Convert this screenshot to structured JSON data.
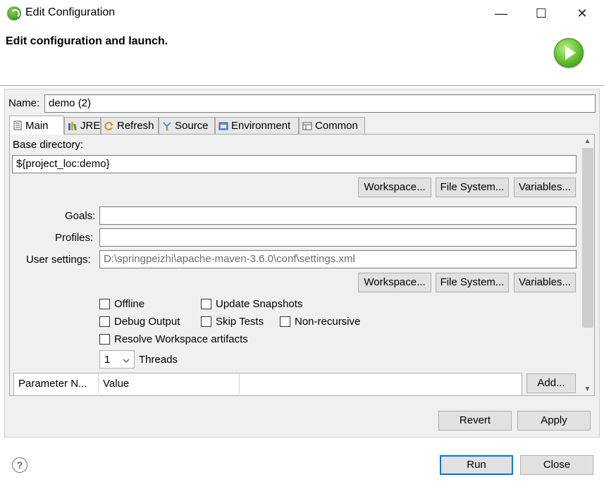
{
  "window": {
    "title": "Edit Configuration",
    "minimize": "—",
    "maximize": "☐",
    "close": "✕"
  },
  "header": {
    "title": "Edit configuration and launch."
  },
  "name": {
    "label": "Name:",
    "value": "demo (2)"
  },
  "tabs": [
    {
      "label": "Main",
      "icon": "document-icon"
    },
    {
      "label": "JRE",
      "icon": "library-icon"
    },
    {
      "label": "Refresh",
      "icon": "refresh-icon"
    },
    {
      "label": "Source",
      "icon": "source-icon"
    },
    {
      "label": "Environment",
      "icon": "environment-icon"
    },
    {
      "label": "Common",
      "icon": "common-icon"
    }
  ],
  "main": {
    "base_directory": {
      "label": "Base directory:",
      "value": "${project_loc:demo}"
    },
    "buttons_row1": {
      "workspace": "Workspace...",
      "file_system": "File System...",
      "variables": "Variables..."
    },
    "goals": {
      "label": "Goals:",
      "value": ""
    },
    "profiles": {
      "label": "Profiles:",
      "value": ""
    },
    "user_settings": {
      "label": "User settings:",
      "value": "D:\\springpeizhi\\apache-maven-3.6.0\\conf\\settings.xml"
    },
    "buttons_row2": {
      "workspace": "Workspace...",
      "file_system": "File System...",
      "variables": "Variables..."
    },
    "checkboxes": {
      "offline": "Offline",
      "update_snapshots": "Update Snapshots",
      "debug_output": "Debug Output",
      "skip_tests": "Skip Tests",
      "non_recursive": "Non-recursive",
      "resolve_workspace": "Resolve Workspace artifacts"
    },
    "threads": {
      "value": "1",
      "label": "Threads"
    },
    "parameters_table": {
      "columns": [
        "Parameter N...",
        "Value"
      ],
      "add_button": "Add..."
    }
  },
  "actions": {
    "revert": "Revert",
    "apply": "Apply",
    "run": "Run",
    "close": "Close"
  }
}
